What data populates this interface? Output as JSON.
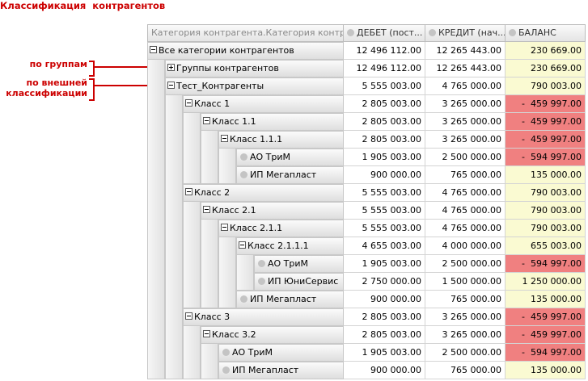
{
  "title": "Классификация  контрагентов",
  "annotations": {
    "by_groups": "по группам",
    "by_external_line1": "по внешней",
    "by_external_line2": "классификации"
  },
  "headers": {
    "category": "Категория контрагента.Категория контр...",
    "debit": "ДЕБЕТ (пост...",
    "credit": "КРЕДИТ (нач...",
    "balance": "БАЛАНС"
  },
  "colors": {
    "accent": "#cc0000",
    "balance_positive": "#fafad2",
    "balance_negative": "#f08080"
  },
  "rows": [
    {
      "label": "Все категории контрагентов",
      "debit": "12 496 112.00",
      "credit": "12 265 443.00",
      "balance": "230 669.00"
    },
    {
      "label": "Группы контрагентов",
      "debit": "12 496 112.00",
      "credit": "12 265 443.00",
      "balance": "230 669.00"
    },
    {
      "label": "Тест_Контрагенты",
      "debit": "5 555 003.00",
      "credit": "4 765 000.00",
      "balance": "790 003.00"
    },
    {
      "label": "Класс 1",
      "debit": "2 805 003.00",
      "credit": "3 265 000.00",
      "balance": "-  459 997.00"
    },
    {
      "label": "Класс 1.1",
      "debit": "2 805 003.00",
      "credit": "3 265 000.00",
      "balance": "-  459 997.00"
    },
    {
      "label": "Класс 1.1.1",
      "debit": "2 805 003.00",
      "credit": "3 265 000.00",
      "balance": "-  459 997.00"
    },
    {
      "label": "АО ТриМ",
      "debit": "1 905 003.00",
      "credit": "2 500 000.00",
      "balance": "-  594 997.00"
    },
    {
      "label": "ИП Мегапласт",
      "debit": "900 000.00",
      "credit": "765 000.00",
      "balance": "135 000.00"
    },
    {
      "label": "Класс 2",
      "debit": "5 555 003.00",
      "credit": "4 765 000.00",
      "balance": "790 003.00"
    },
    {
      "label": "Класс 2.1",
      "debit": "5 555 003.00",
      "credit": "4 765 000.00",
      "balance": "790 003.00"
    },
    {
      "label": "Класс 2.1.1",
      "debit": "5 555 003.00",
      "credit": "4 765 000.00",
      "balance": "790 003.00"
    },
    {
      "label": "Класс 2.1.1.1",
      "debit": "4 655 003.00",
      "credit": "4 000 000.00",
      "balance": "655 003.00"
    },
    {
      "label": "АО ТриМ",
      "debit": "1 905 003.00",
      "credit": "2 500 000.00",
      "balance": "-  594 997.00"
    },
    {
      "label": "ИП ЮниСервис",
      "debit": "2 750 000.00",
      "credit": "1 500 000.00",
      "balance": "1 250 000.00"
    },
    {
      "label": "ИП Мегапласт",
      "debit": "900 000.00",
      "credit": "765 000.00",
      "balance": "135 000.00"
    },
    {
      "label": "Класс 3",
      "debit": "2 805 003.00",
      "credit": "3 265 000.00",
      "balance": "-  459 997.00"
    },
    {
      "label": "Класс 3.2",
      "debit": "2 805 003.00",
      "credit": "3 265 000.00",
      "balance": "-  459 997.00"
    },
    {
      "label": "АО ТриМ",
      "debit": "1 905 003.00",
      "credit": "2 500 000.00",
      "balance": "-  594 997.00"
    },
    {
      "label": "ИП Мегапласт",
      "debit": "900 000.00",
      "credit": "765 000.00",
      "balance": "135 000.00"
    }
  ]
}
